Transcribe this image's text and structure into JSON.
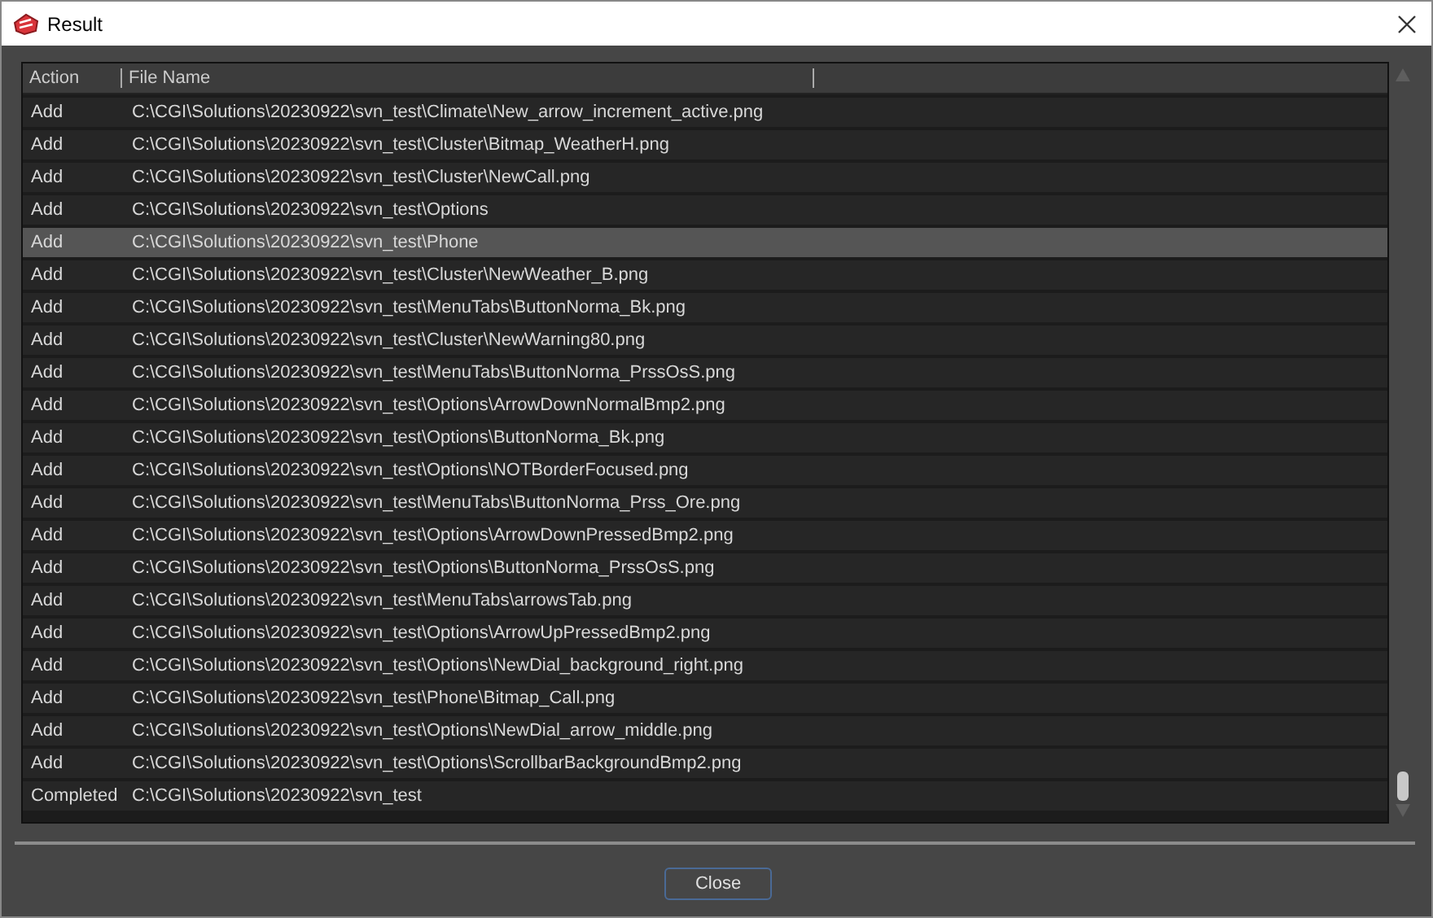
{
  "window": {
    "title": "Result"
  },
  "table": {
    "columns": [
      "Action",
      "File Name"
    ],
    "rows": [
      {
        "action": "Add",
        "file": "C:\\CGI\\Solutions\\20230922\\svn_test\\Climate\\New_arrow_increment_active.png",
        "selected": false
      },
      {
        "action": "Add",
        "file": "C:\\CGI\\Solutions\\20230922\\svn_test\\Cluster\\Bitmap_WeatherH.png",
        "selected": false
      },
      {
        "action": "Add",
        "file": "C:\\CGI\\Solutions\\20230922\\svn_test\\Cluster\\NewCall.png",
        "selected": false
      },
      {
        "action": "Add",
        "file": "C:\\CGI\\Solutions\\20230922\\svn_test\\Options",
        "selected": false
      },
      {
        "action": "Add",
        "file": "C:\\CGI\\Solutions\\20230922\\svn_test\\Phone",
        "selected": true
      },
      {
        "action": "Add",
        "file": "C:\\CGI\\Solutions\\20230922\\svn_test\\Cluster\\NewWeather_B.png",
        "selected": false
      },
      {
        "action": "Add",
        "file": "C:\\CGI\\Solutions\\20230922\\svn_test\\MenuTabs\\ButtonNorma_Bk.png",
        "selected": false
      },
      {
        "action": "Add",
        "file": "C:\\CGI\\Solutions\\20230922\\svn_test\\Cluster\\NewWarning80.png",
        "selected": false
      },
      {
        "action": "Add",
        "file": "C:\\CGI\\Solutions\\20230922\\svn_test\\MenuTabs\\ButtonNorma_PrssOsS.png",
        "selected": false
      },
      {
        "action": "Add",
        "file": "C:\\CGI\\Solutions\\20230922\\svn_test\\Options\\ArrowDownNormalBmp2.png",
        "selected": false
      },
      {
        "action": "Add",
        "file": "C:\\CGI\\Solutions\\20230922\\svn_test\\Options\\ButtonNorma_Bk.png",
        "selected": false
      },
      {
        "action": "Add",
        "file": "C:\\CGI\\Solutions\\20230922\\svn_test\\Options\\NOTBorderFocused.png",
        "selected": false
      },
      {
        "action": "Add",
        "file": "C:\\CGI\\Solutions\\20230922\\svn_test\\MenuTabs\\ButtonNorma_Prss_Ore.png",
        "selected": false
      },
      {
        "action": "Add",
        "file": "C:\\CGI\\Solutions\\20230922\\svn_test\\Options\\ArrowDownPressedBmp2.png",
        "selected": false
      },
      {
        "action": "Add",
        "file": "C:\\CGI\\Solutions\\20230922\\svn_test\\Options\\ButtonNorma_PrssOsS.png",
        "selected": false
      },
      {
        "action": "Add",
        "file": "C:\\CGI\\Solutions\\20230922\\svn_test\\MenuTabs\\arrowsTab.png",
        "selected": false
      },
      {
        "action": "Add",
        "file": "C:\\CGI\\Solutions\\20230922\\svn_test\\Options\\ArrowUpPressedBmp2.png",
        "selected": false
      },
      {
        "action": "Add",
        "file": "C:\\CGI\\Solutions\\20230922\\svn_test\\Options\\NewDial_background_right.png",
        "selected": false
      },
      {
        "action": "Add",
        "file": "C:\\CGI\\Solutions\\20230922\\svn_test\\Phone\\Bitmap_Call.png",
        "selected": false
      },
      {
        "action": "Add",
        "file": "C:\\CGI\\Solutions\\20230922\\svn_test\\Options\\NewDial_arrow_middle.png",
        "selected": false
      },
      {
        "action": "Add",
        "file": "C:\\CGI\\Solutions\\20230922\\svn_test\\Options\\ScrollbarBackgroundBmp2.png",
        "selected": false
      },
      {
        "action": "Completed",
        "file": "C:\\CGI\\Solutions\\20230922\\svn_test",
        "selected": false
      }
    ]
  },
  "buttons": [
    "Close"
  ]
}
